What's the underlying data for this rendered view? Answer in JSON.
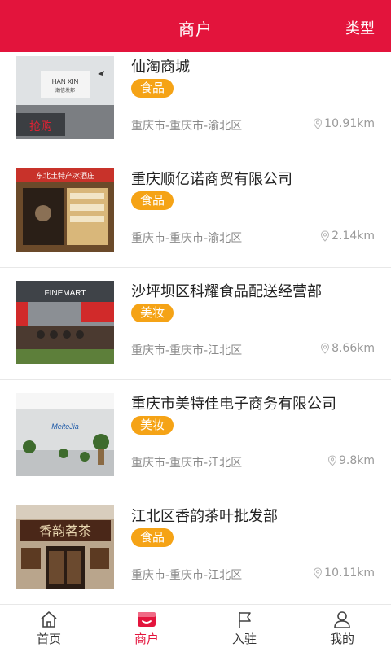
{
  "header": {
    "title": "商户",
    "type_label": "类型",
    "accent": "#e3143c"
  },
  "merchants": [
    {
      "name": "仙淘商城",
      "tag": "食品",
      "address": "重庆市-重庆市-渝北区",
      "distance": "10.91km",
      "thumb_text": "HAN XIN",
      "thumb_subtext": "瀚信发邦",
      "thumb_extra": "抢购"
    },
    {
      "name": "重庆顺亿诺商贸有限公司",
      "tag": "食品",
      "address": "重庆市-重庆市-渝北区",
      "distance": "2.14km",
      "thumb_text": "东北土特产冰酒庄"
    },
    {
      "name": "沙坪坝区科耀食品配送经营部",
      "tag": "美妆",
      "address": "重庆市-重庆市-江北区",
      "distance": "8.66km",
      "thumb_text": "FINEMART"
    },
    {
      "name": "重庆市美特佳电子商务有限公司",
      "tag": "美妆",
      "address": "重庆市-重庆市-江北区",
      "distance": "9.8km",
      "thumb_text": "MeiteJia"
    },
    {
      "name": "江北区香韵茶叶批发部",
      "tag": "食品",
      "address": "重庆市-重庆市-江北区",
      "distance": "10.11km",
      "thumb_text": "香韵茗茶"
    }
  ],
  "tabs": [
    {
      "label": "首页",
      "icon": "home-icon"
    },
    {
      "label": "商户",
      "icon": "store-icon",
      "active": true
    },
    {
      "label": "入驻",
      "icon": "flag-icon"
    },
    {
      "label": "我的",
      "icon": "user-icon"
    }
  ]
}
